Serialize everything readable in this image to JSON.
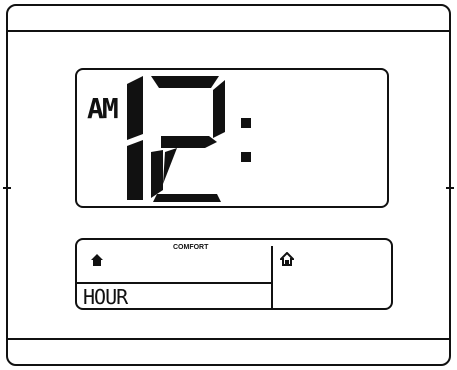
{
  "display": {
    "ampm": "AM",
    "hour": "12",
    "colon": ":"
  },
  "lower_panel": {
    "comfort_label": "COMFORT",
    "mode_label": "HOUR",
    "left_icon": "home-filled-icon",
    "right_icon": "home-outline-icon"
  },
  "colors": {
    "lcd_segment": "#111111",
    "background": "#ffffff"
  }
}
